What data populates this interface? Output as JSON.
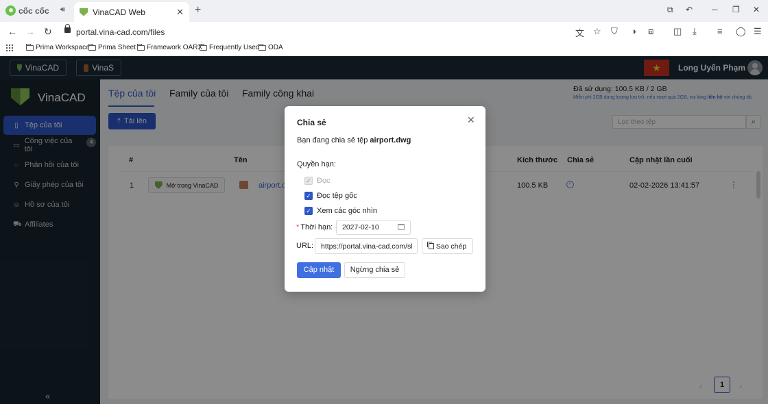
{
  "browser": {
    "brand": "cốc cốc",
    "tab_title": "VinaCAD Web",
    "url": "portal.vina-cad.com/files",
    "bookmarks": [
      "Prima Workspace",
      "Prima Sheet",
      "Framework OARX",
      "Frequently Used",
      "ODA"
    ]
  },
  "header": {
    "apps": [
      "VinaCAD",
      "VinaS"
    ],
    "flag_star": "★",
    "user_name": "Long Uyển Phạm"
  },
  "sidebar": {
    "brand": "VinaCAD",
    "items": [
      {
        "label": "Tệp của tôi",
        "icon": "file-icon"
      },
      {
        "label": "Công việc của tôi",
        "icon": "briefcase-icon",
        "badge": "4"
      },
      {
        "label": "Phản hồi của tôi",
        "icon": "feedback-icon"
      },
      {
        "label": "Giấy phép của tôi",
        "icon": "key-icon"
      },
      {
        "label": "Hồ sơ của tôi",
        "icon": "user-icon"
      },
      {
        "label": "Affiliates",
        "icon": "cart-icon"
      }
    ],
    "collapse": "«"
  },
  "main": {
    "tabs": [
      "Tệp của tôi",
      "Family của tôi",
      "Family công khai"
    ],
    "usage": "Đã sử dụng: 100.5 KB / 2 GB",
    "usage_note_pre": "Miễn phí 2GB dung lượng lưu trữ, nếu vượt quá 2GB, vui lòng ",
    "usage_note_link": "liên hệ",
    "usage_note_post": " với chúng tôi.",
    "upload_label": "Tải lên",
    "search_placeholder": "Lọc theo tệp",
    "table": {
      "headers": [
        "#",
        "Tên",
        "Kích thước",
        "Chia sẻ",
        "Cập nhật lần cuối"
      ],
      "rows": [
        {
          "index": "1",
          "open_label": "Mở trong VinaCAD",
          "name": "airport.dwg",
          "size": "100.5 KB",
          "shared": true,
          "updated": "02-02-2026 13:41:57"
        }
      ]
    },
    "pager": {
      "page": "1"
    }
  },
  "modal": {
    "title": "Chia sẻ",
    "desc_prefix": "Bạn đang chia sẻ tệp ",
    "file_name": "airport.dwg",
    "permissions_label": "Quyền hạn:",
    "permissions": [
      {
        "label": "Đọc",
        "checked": true,
        "disabled": true
      },
      {
        "label": "Đọc tệp gốc",
        "checked": true,
        "disabled": false
      },
      {
        "label": "Xem các góc nhìn",
        "checked": true,
        "disabled": false
      }
    ],
    "expiry_label": "Thời hạn:",
    "expiry_value": "2027-02-10",
    "url_label": "URL:",
    "url_value": "https://portal.vina-cad.com/sl",
    "copy_label": "Sao chép",
    "update_label": "Cập nhật",
    "stop_label": "Ngừng chia sẻ"
  }
}
